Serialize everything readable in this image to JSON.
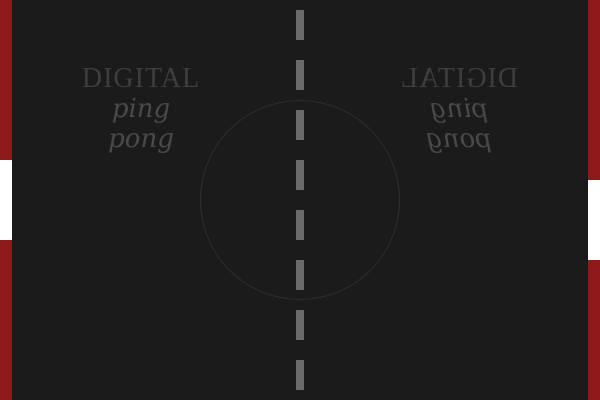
{
  "game": {
    "logo_left": {
      "line1": "DIGITAL",
      "line2": "ping pong"
    },
    "logo_right": {
      "line1": "DIGITAL",
      "line2": "ping pong"
    }
  },
  "colors": {
    "table": "#1b1b1b",
    "wall": "#8c1a1a",
    "paddle": "#ffffff",
    "net": "#6b6b6b"
  }
}
